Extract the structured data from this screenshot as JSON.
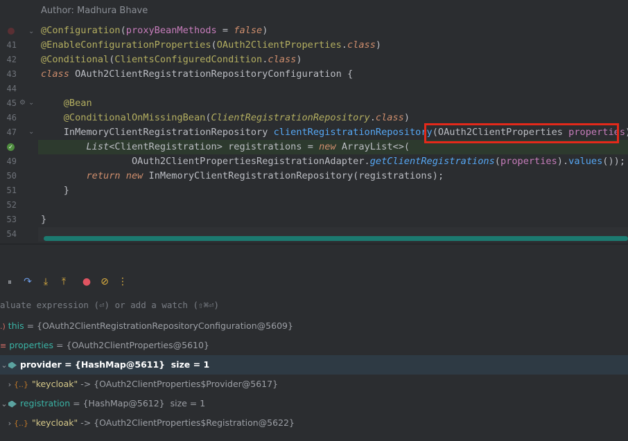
{
  "editor": {
    "author_label": "Author:",
    "author_name": "Madhura Bhave",
    "line_numbers": [
      "41",
      "42",
      "43",
      "44",
      "45",
      "46",
      "47",
      "49",
      "50",
      "51",
      "52",
      "53",
      "54"
    ],
    "lines": {
      "l40_anno": "@Configuration",
      "l40_arg": "proxyBeanMethods",
      "l40_eq": " = ",
      "l40_val": "false",
      "l41_anno": "@EnableConfigurationProperties",
      "l41_cls": "OAuth2ClientProperties",
      "l41_kw": "class",
      "l42_anno": "@Conditional",
      "l42_cls": "ClientsConfiguredCondition",
      "l42_kw": "class",
      "l43_kw": "class",
      "l43_name": "OAuth2ClientRegistrationRepositoryConfiguration",
      "l45_anno": "@Bean",
      "l46_anno": "@ConditionalOnMissingBean",
      "l46_cls": "ClientRegistrationRepository",
      "l46_kw": "class",
      "l47_type": "InMemoryClientRegistrationRepository",
      "l47_method": "clientRegistrationRepository",
      "l47_ptype": "OAuth2ClientProperties",
      "l47_pname": "properties",
      "l48_type": "List",
      "l48_typearg": "ClientRegistration",
      "l48_var": "registrations",
      "l48_new": "new",
      "l48_cls": "ArrayList",
      "l49_cls": "OAuth2ClientPropertiesRegistrationAdapter",
      "l49_method": "getClientRegistrations",
      "l49_arg": "properties",
      "l49_values": "values",
      "l50_return": "return",
      "l50_new": "new",
      "l50_cls": "InMemoryClientRegistrationRepository",
      "l50_arg": "registrations"
    }
  },
  "debugger": {
    "eval_placeholder": "aluate expression (⏎) or add a watch (⇧⌘⏎)",
    "variables": [
      {
        "name": "this",
        "value": "{OAuth2ClientRegistrationRepositoryConfiguration@5609}"
      },
      {
        "name": "properties",
        "value": "{OAuth2ClientProperties@5610}"
      },
      {
        "name": "provider",
        "value": "{HashMap@5611}",
        "extra": "size = 1"
      },
      {
        "name": "\"keycloak\"",
        "value": "{OAuth2ClientProperties$Provider@5617}"
      },
      {
        "name": "registration",
        "value": "{HashMap@5612}",
        "extra": "size = 1"
      },
      {
        "name": "\"keycloak\"",
        "value": "{OAuth2ClientProperties$Registration@5622}"
      }
    ]
  },
  "colors": {
    "highlight_box": "#e4291a",
    "annotation": "#b3ae60",
    "keyword": "#cf8e6d",
    "parameter": "#c77dbb",
    "method": "#56a8f5",
    "progress_teal": "#1c7a70"
  }
}
